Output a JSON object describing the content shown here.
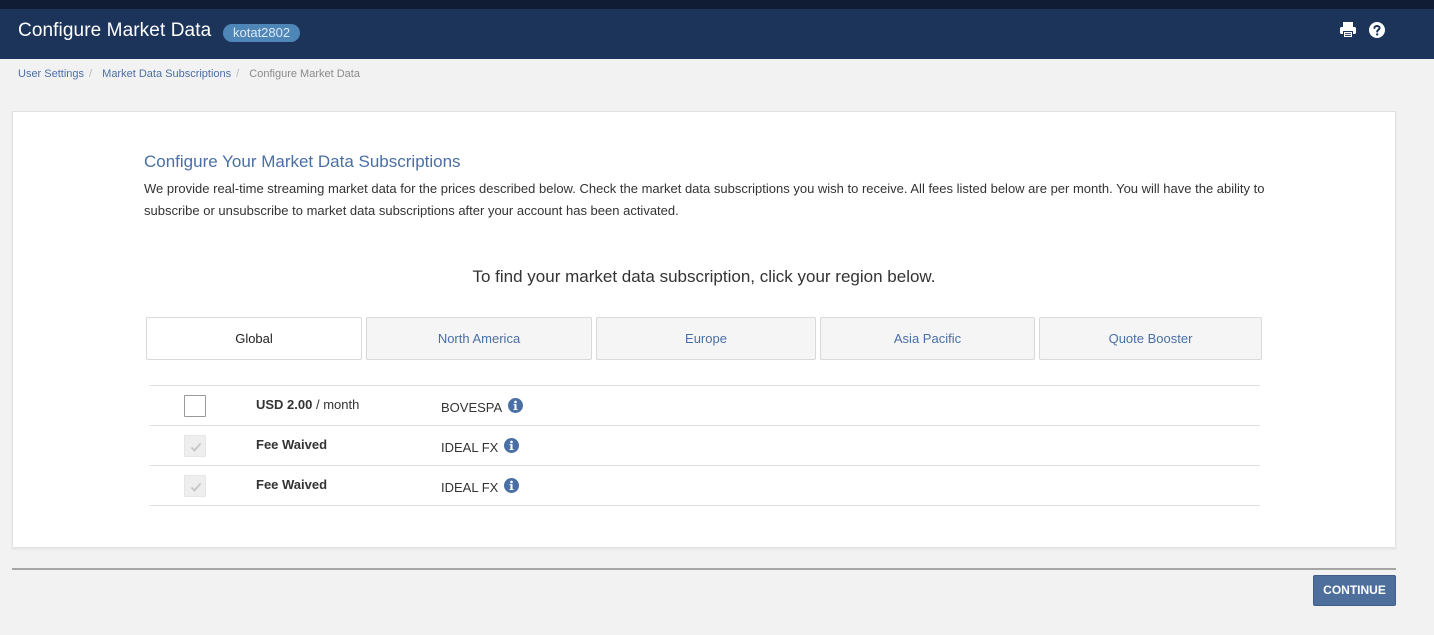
{
  "header": {
    "title": "Configure Market Data",
    "user_badge": "kotat2802"
  },
  "breadcrumb": {
    "items": [
      "User Settings",
      "Market Data Subscriptions"
    ],
    "current": "Configure Market Data"
  },
  "content": {
    "title": "Configure Your Market Data Subscriptions",
    "description": "We provide real-time streaming market data for the prices described below. Check the market data subscriptions you wish to receive. All fees listed below are per month. You will have the ability to subscribe or unsubscribe to market data subscriptions after your account has been activated.",
    "region_prompt": "To find your market data subscription, click your region below."
  },
  "tabs": [
    {
      "label": "Global",
      "active": true
    },
    {
      "label": "North America",
      "active": false
    },
    {
      "label": "Europe",
      "active": false
    },
    {
      "label": "Asia Pacific",
      "active": false
    },
    {
      "label": "Quote Booster",
      "active": false
    }
  ],
  "subscriptions": [
    {
      "fee": "USD 2.00",
      "unit": " / month",
      "exchange": "BOVESPA",
      "checked": false,
      "disabled": false
    },
    {
      "fee": "Fee Waived",
      "unit": "",
      "exchange": "IDEAL FX",
      "checked": true,
      "disabled": true
    },
    {
      "fee": "Fee Waived",
      "unit": "",
      "exchange": "IDEAL FX",
      "checked": true,
      "disabled": true
    }
  ],
  "footer": {
    "continue_label": "CONTINUE"
  },
  "icons": {
    "print": "print-icon",
    "help": "help-icon",
    "info": "info-icon",
    "check": "check-icon"
  },
  "colors": {
    "header_bg": "#1c3459",
    "accent": "#4a6fa5",
    "badge_bg": "#4f86b8",
    "button_bg": "#4e6f9b"
  }
}
